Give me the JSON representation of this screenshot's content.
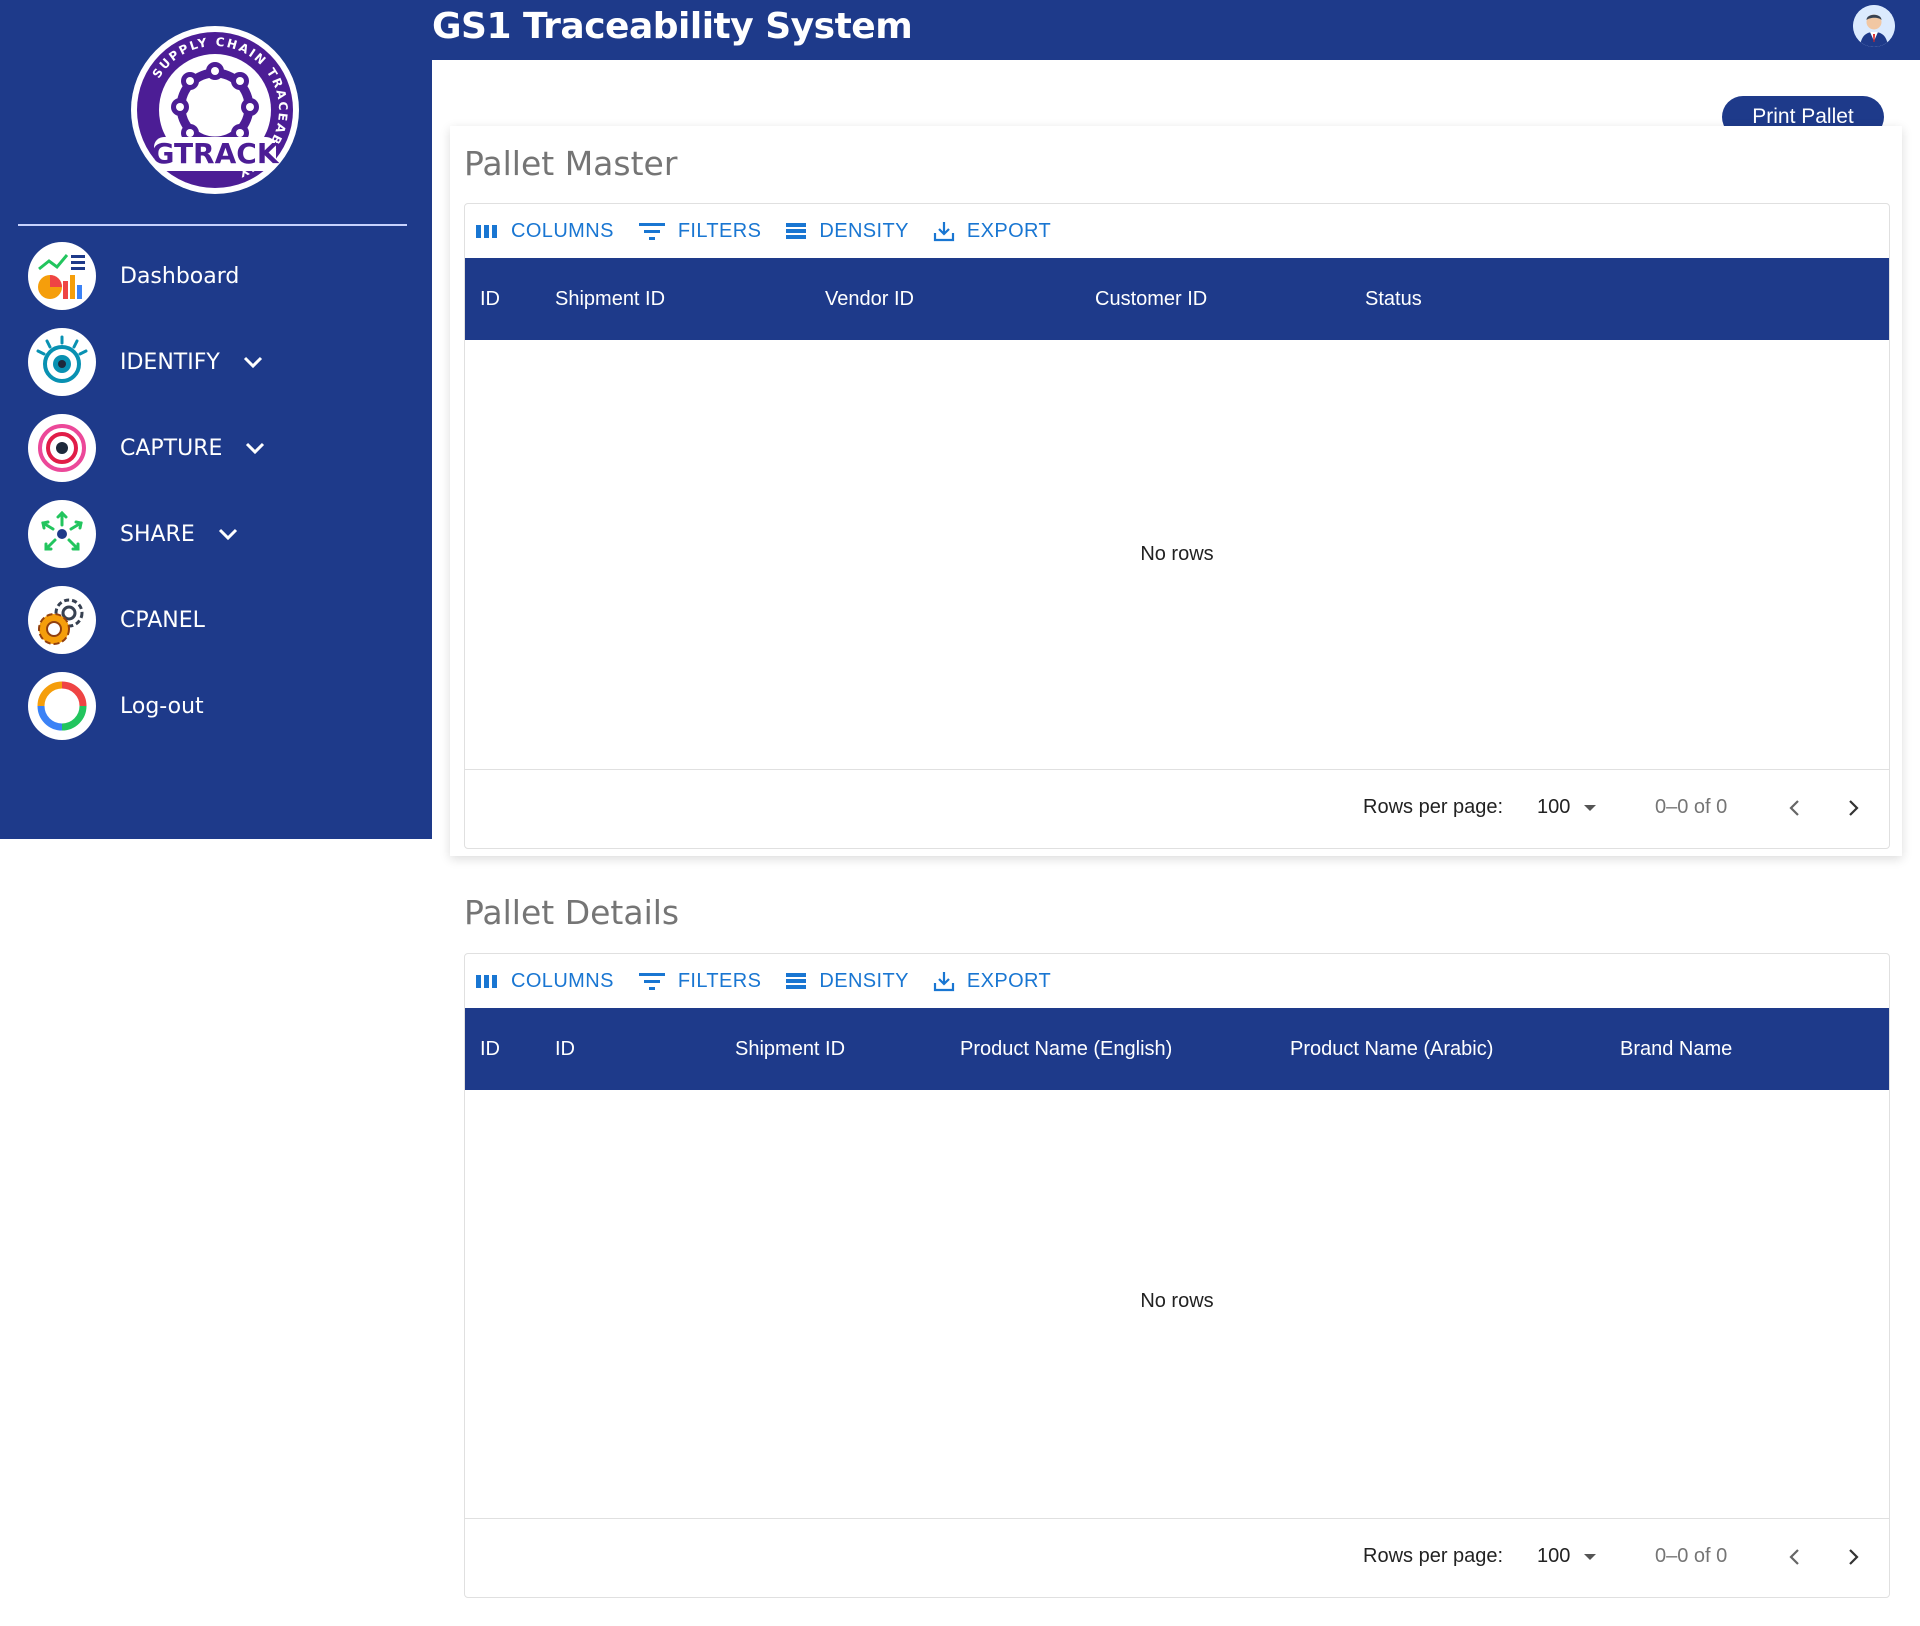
{
  "app": {
    "title": "GS1 Traceability System",
    "logo_text": "GTRACK",
    "logo_ring_text": "SUPPLY CHAIN TRACEABILITY"
  },
  "sidebar": {
    "items": [
      {
        "label": "Dashboard",
        "icon": "dashboard-icon",
        "expandable": false
      },
      {
        "label": "IDENTIFY",
        "icon": "eye-icon",
        "expandable": true
      },
      {
        "label": "CAPTURE",
        "icon": "target-icon",
        "expandable": true
      },
      {
        "label": "SHARE",
        "icon": "share-icon",
        "expandable": true
      },
      {
        "label": "CPANEL",
        "icon": "gear-icon",
        "expandable": false
      },
      {
        "label": "Log-out",
        "icon": "logout-icon",
        "expandable": false
      }
    ]
  },
  "actions": {
    "print_pallet": "Print Pallet"
  },
  "toolbar": {
    "columns": "COLUMNS",
    "filters": "FILTERS",
    "density": "DENSITY",
    "export": "EXPORT"
  },
  "pallet_master": {
    "title": "Pallet Master",
    "columns": [
      "ID",
      "Shipment ID",
      "Vendor ID",
      "Customer ID",
      "Status"
    ],
    "empty_text": "No rows",
    "rows_per_page_label": "Rows per page:",
    "rows_per_page": "100",
    "range": "0–0 of 0"
  },
  "pallet_details": {
    "title": "Pallet Details",
    "columns": [
      "ID",
      "ID",
      "Shipment ID",
      "Product Name (English)",
      "Product Name (Arabic)",
      "Brand Name"
    ],
    "empty_text": "No rows",
    "rows_per_page_label": "Rows per page:",
    "rows_per_page": "100",
    "range": "0–0 of 0"
  },
  "colors": {
    "primary": "#1e3a8a",
    "link": "#1976d2",
    "muted": "#757575"
  }
}
